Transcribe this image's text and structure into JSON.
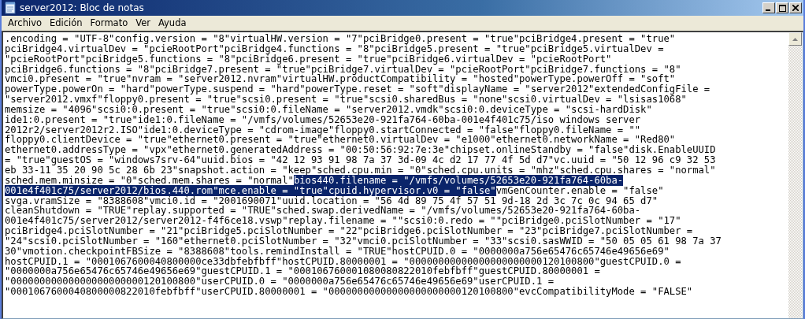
{
  "window": {
    "title": "server2012: Bloc de notas"
  },
  "menu": [
    "Archivo",
    "Edición",
    "Formato",
    "Ver",
    "Ayuda"
  ],
  "lines": [
    {
      "segments": [
        {
          "text": ".encoding = \"UTF-8\"config.version = \"8\"virtualHW.version = \"7\"pciBridge0.present = \"true\"pciBridge4.present = \"true\"",
          "selected": false
        }
      ]
    },
    {
      "segments": [
        {
          "text": "pciBridge4.virtualDev = \"pcieRootPort\"pciBridge4.functions = \"8\"pciBridge5.present = \"true\"pciBridge5.virtualDev =",
          "selected": false
        }
      ]
    },
    {
      "segments": [
        {
          "text": "\"pcieRootPort\"pciBridge5.functions = \"8\"pciBridge6.present = \"true\"pciBridge6.virtualDev = \"pcieRootPort\"",
          "selected": false
        }
      ]
    },
    {
      "segments": [
        {
          "text": "pciBridge6.functions = \"8\"pciBridge7.present = \"true\"pciBridge7.virtualDev = \"pcieRootPort\"pciBridge7.functions = \"8\"",
          "selected": false
        }
      ]
    },
    {
      "segments": [
        {
          "text": "vmci0.present = \"true\"nvram = \"server2012.nvram\"virtualHW.productCompatibility = \"hosted\"powerType.powerOff = \"soft\"",
          "selected": false
        }
      ]
    },
    {
      "segments": [
        {
          "text": "powerType.powerOn = \"hard\"powerType.suspend = \"hard\"powerType.reset = \"soft\"displayName = \"server2012\"extendedConfigFile =",
          "selected": false
        }
      ]
    },
    {
      "segments": [
        {
          "text": "\"server2012.vmxf\"floppy0.present = \"true\"scsi0.present = \"true\"scsi0.sharedBus = \"none\"scsi0.virtualDev = \"lsisas1068\"",
          "selected": false
        }
      ]
    },
    {
      "segments": [
        {
          "text": "memsize = \"4096\"scsi0:0.present = \"true\"scsi0:0.fileName = \"server2012.vmdk\"scsi0:0.deviceType = \"scsi-hardDisk\"",
          "selected": false
        }
      ]
    },
    {
      "segments": [
        {
          "text": "ide1:0.present = \"true\"ide1:0.fileName = \"/vmfs/volumes/52653e20-921fa764-60ba-001e4f401c75/iso windows server",
          "selected": false
        }
      ]
    },
    {
      "segments": [
        {
          "text": "2012r2/server2012r2.ISO\"ide1:0.deviceType = \"cdrom-image\"floppy0.startConnected = \"false\"floppy0.fileName = \"\"",
          "selected": false
        }
      ]
    },
    {
      "segments": [
        {
          "text": "floppy0.clientDevice = \"true\"ethernet0.present = \"true\"ethernet0.virtualDev = \"e1000\"ethernet0.networkName = \"Red80\"",
          "selected": false
        }
      ]
    },
    {
      "segments": [
        {
          "text": "ethernet0.addressType = \"vpx\"ethernet0.generatedAddress = \"00:50:56:92:7e:3e\"chipset.onlineStandby = \"false\"disk.EnableUUID",
          "selected": false
        }
      ]
    },
    {
      "segments": [
        {
          "text": "= \"true\"guestOS = \"windows7srv-64\"uuid.bios = \"42 12 93 91 98 7a 37 3d-09 4c d2 17 77 4f 5d d7\"vc.uuid = \"50 12 96 c9 32 53",
          "selected": false
        }
      ]
    },
    {
      "segments": [
        {
          "text": "eb 33-11 35 20 90 5c 28 6b 23\"snapshot.action = \"keep\"sched.cpu.min = \"0\"sched.cpu.units = \"mhz\"sched.cpu.shares = \"normal\"",
          "selected": false
        }
      ]
    },
    {
      "segments": [
        {
          "text": "sched.mem.minsize = \"0\"sched.mem.shares = \"normal\"",
          "selected": false
        },
        {
          "text": "bios440.filename = \"/vmfs/volumes/52653e20-921fa764-60ba-",
          "selected": true
        }
      ]
    },
    {
      "segments": [
        {
          "text": "001e4f401c75/server2012/bios.440.rom\"mce.enable = \"true\"cpuid.hypervisor.v0 = \"false\"",
          "selected": true
        },
        {
          "text": "vmGenCounter.enable = \"false\"",
          "selected": false
        }
      ]
    },
    {
      "segments": [
        {
          "text": "svga.vramSize = \"8388608\"vmci0.id = \"2001690071\"uuid.location = \"56 4d 89 75 4f 57 51 9d-18 2d 3c 7c 0c 94 65 d7\"",
          "selected": false
        }
      ]
    },
    {
      "segments": [
        {
          "text": "cleanShutdown = \"TRUE\"replay.supported = \"TRUE\"sched.swap.derivedName = \"/vmfs/volumes/52653e20-921fa764-60ba-",
          "selected": false
        }
      ]
    },
    {
      "segments": [
        {
          "text": "001e4f401c75/server2012/server2012-f4f6ce18.vswp\"replay.filename = \"\"scsi0:0.redo = \"\"pciBridge0.pciSlotNumber = \"17\"",
          "selected": false
        }
      ]
    },
    {
      "segments": [
        {
          "text": "pciBridge4.pciSlotNumber = \"21\"pciBridge5.pciSlotNumber = \"22\"pciBridge6.pciSlotNumber = \"23\"pciBridge7.pciSlotNumber =",
          "selected": false
        }
      ]
    },
    {
      "segments": [
        {
          "text": "\"24\"scsi0.pciSlotNumber = \"160\"ethernet0.pciSlotNumber = \"32\"vmci0.pciSlotNumber = \"33\"scsi0.sasWWID = \"50 05 05 61 98 7a 37",
          "selected": false
        }
      ]
    },
    {
      "segments": [
        {
          "text": "30\"vmotion.checkpointFBSize = \"8388608\"tools.remindInstall = \"TRUE\"hostCPUID.0 = \"0000000a756e65476c65746e49656e69\"",
          "selected": false
        }
      ]
    },
    {
      "segments": [
        {
          "text": "hostCPUID.1 = \"0001067600040800000ce33dbfebfbff\"hostCPUID.80000001 = \"00000000000000000000000120100800\"guestCPUID.0 =",
          "selected": false
        }
      ]
    },
    {
      "segments": [
        {
          "text": "\"0000000a756e65476c65746e49656e69\"guestCPUID.1 = \"000106760001080080822010febfbff\"guestCPUID.80000001 =",
          "selected": false
        }
      ]
    },
    {
      "segments": [
        {
          "text": "\"00000000000000000000000120100800\"userCPUID.0 = \"0000000a756e65476c65746e49656e69\"userCPUID.1 =",
          "selected": false
        }
      ]
    },
    {
      "segments": [
        {
          "text": "\"0001067600040800000822010febfbff\"userCPUID.80000001 = \"00000000000000000000000120100800\"evcCompatibilityMode = \"FALSE\"",
          "selected": false
        }
      ]
    }
  ]
}
